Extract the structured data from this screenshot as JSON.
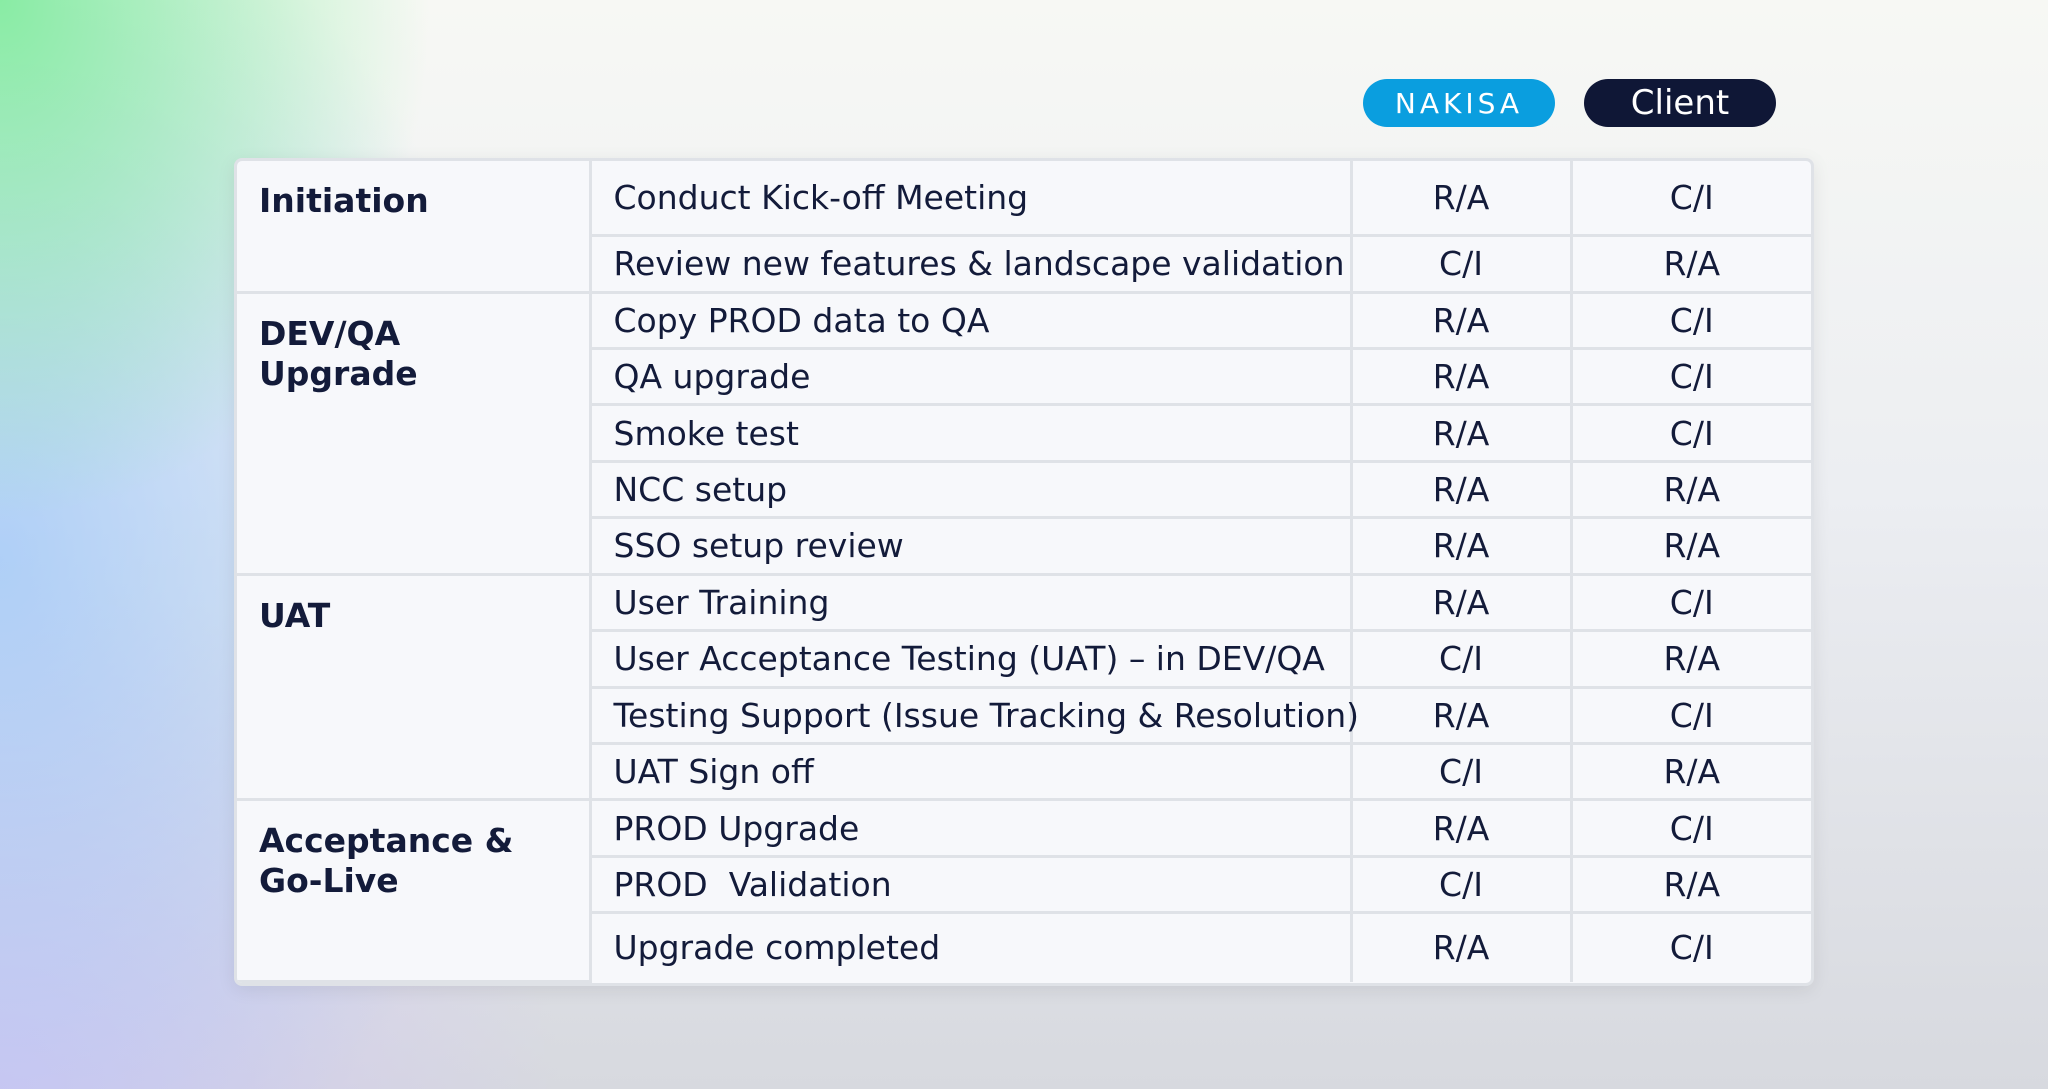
{
  "header": {
    "nakisa_label": "NAKISA",
    "client_label": "Client"
  },
  "phases": [
    {
      "name": "Initiation",
      "tasks": [
        {
          "task": "Conduct Kick-off Meeting",
          "nakisa": "R/A",
          "client": "C/I"
        },
        {
          "task": "Review new features & landscape validation",
          "nakisa": "C/I",
          "client": "R/A"
        }
      ]
    },
    {
      "name": "DEV/QA Upgrade",
      "tasks": [
        {
          "task": "Copy PROD data to QA",
          "nakisa": "R/A",
          "client": "C/I"
        },
        {
          "task": "QA upgrade",
          "nakisa": "R/A",
          "client": "C/I"
        },
        {
          "task": "Smoke test",
          "nakisa": "R/A",
          "client": "C/I"
        },
        {
          "task": "NCC setup",
          "nakisa": "R/A",
          "client": "R/A"
        },
        {
          "task": "SSO setup review",
          "nakisa": "R/A",
          "client": "R/A"
        }
      ]
    },
    {
      "name": "UAT",
      "tasks": [
        {
          "task": "User Training",
          "nakisa": "R/A",
          "client": "C/I"
        },
        {
          "task": "User Acceptance Testing (UAT) – in DEV/QA",
          "nakisa": "C/I",
          "client": "R/A"
        },
        {
          "task": "Testing Support (Issue Tracking & Resolution)",
          "nakisa": "R/A",
          "client": "C/I"
        },
        {
          "task": "UAT Sign off",
          "nakisa": "C/I",
          "client": "R/A"
        }
      ]
    },
    {
      "name": "Acceptance & Go-Live",
      "tasks": [
        {
          "task": "PROD Upgrade",
          "nakisa": "R/A",
          "client": "C/I"
        },
        {
          "task": "PROD  Validation",
          "nakisa": "C/I",
          "client": "R/A"
        },
        {
          "task": "Upgrade completed",
          "nakisa": "R/A",
          "client": "C/I"
        }
      ]
    }
  ]
}
